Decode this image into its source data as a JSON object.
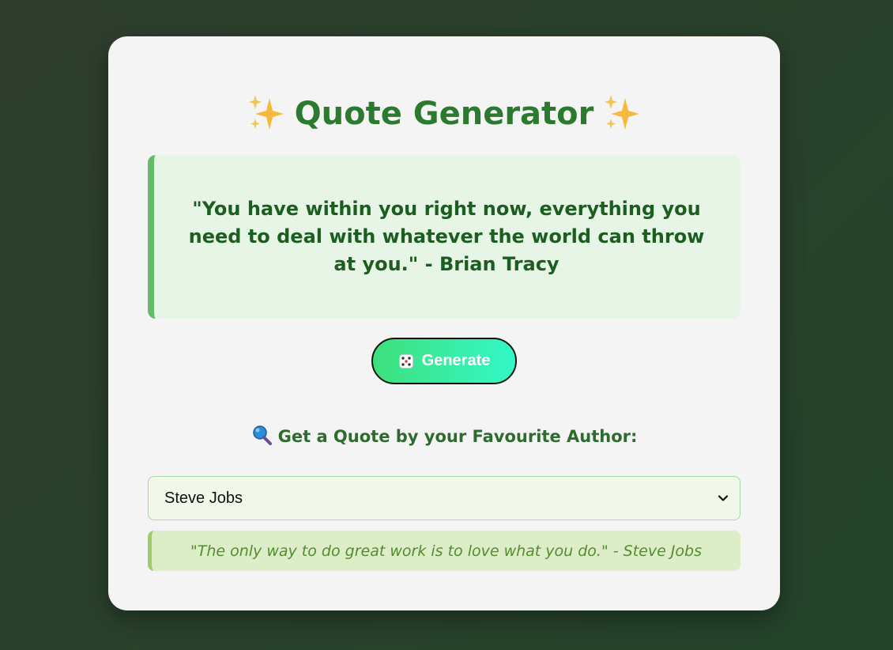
{
  "header": {
    "title": "Quote Generator",
    "left_icon": "sparkles-icon",
    "right_icon": "sparkles-icon"
  },
  "random_quote": {
    "text": "\"You have within you right now, everything you need to deal with whatever the world can throw at you.\" - Brian Tracy"
  },
  "generate_button": {
    "icon": "dice-icon",
    "label": "Generate"
  },
  "author_section": {
    "icon": "magnifier-icon",
    "heading": "Get a Quote by your Favourite Author:",
    "selected_author": "Steve Jobs",
    "quote": "\"The only way to do great work is to love what you do.\" - Steve Jobs"
  },
  "colors": {
    "accent": "#2c7a2f",
    "quote_border": "#66bb6a",
    "button_gradient_start": "#3ee07c",
    "button_gradient_end": "#34f7c8"
  }
}
